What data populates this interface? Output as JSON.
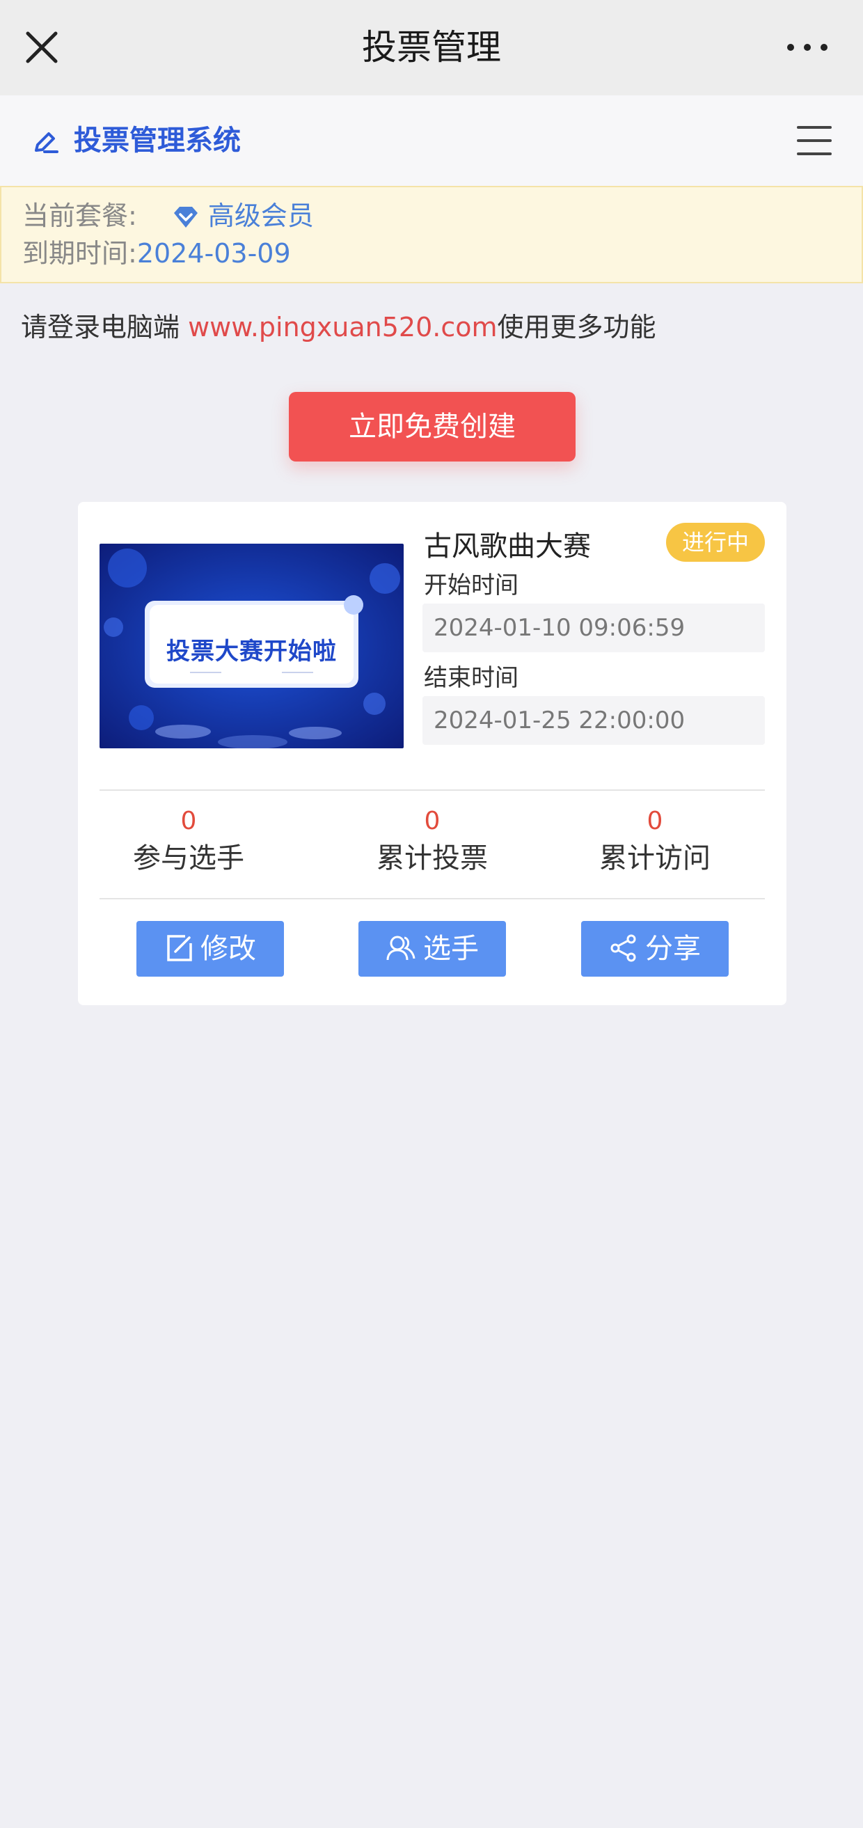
{
  "topbar": {
    "title": "投票管理"
  },
  "subheader": {
    "brand": "投票管理系统"
  },
  "plan": {
    "package_label": "当前套餐:",
    "package_value": "高级会员",
    "expiry_label": "到期时间:",
    "expiry_value": "2024-03-09"
  },
  "notice": {
    "prefix": "请登录电脑端 ",
    "url": "www.pingxuan520.com",
    "suffix": "使用更多功能"
  },
  "cta": {
    "label": "立即免费创建"
  },
  "vote_card": {
    "cover_text": "投票大赛开始啦",
    "title": "古风歌曲大赛",
    "status": "进行中",
    "start_label": "开始时间",
    "start_value": "2024-01-10 09:06:59",
    "end_label": "结束时间",
    "end_value": "2024-01-25 22:00:00",
    "stats": [
      {
        "value": "0",
        "label": "参与选手"
      },
      {
        "value": "0",
        "label": "累计投票"
      },
      {
        "value": "0",
        "label": "累计访问"
      }
    ],
    "actions": [
      {
        "label": "修改",
        "icon": "edit-icon"
      },
      {
        "label": "选手",
        "icon": "users-icon"
      },
      {
        "label": "分享",
        "icon": "share-icon"
      }
    ]
  },
  "colors": {
    "brand_blue": "#2e5bd8",
    "cta_red": "#f25252",
    "action_blue": "#5b92f2",
    "badge_yellow": "#f7c544",
    "stat_red": "#e24b3c"
  }
}
